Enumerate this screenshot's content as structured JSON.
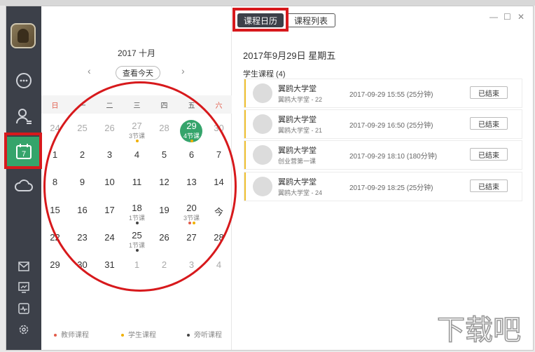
{
  "calendar": {
    "month_title": "2017 十月",
    "today_button": "查看今天",
    "weekdays": [
      "日",
      "一",
      "二",
      "三",
      "四",
      "五",
      "六"
    ],
    "weeks": [
      [
        {
          "d": "24",
          "dim": true
        },
        {
          "d": "25",
          "dim": true
        },
        {
          "d": "26",
          "dim": true
        },
        {
          "d": "27",
          "dim": true,
          "sub": "3节课",
          "dots": [
            "#f0b000"
          ]
        },
        {
          "d": "28",
          "dim": true
        },
        {
          "d": "29",
          "selected": true,
          "sub": "4节课",
          "dots": [
            "#f0b000"
          ]
        },
        {
          "d": "30",
          "dim": true
        }
      ],
      [
        {
          "d": "1"
        },
        {
          "d": "2"
        },
        {
          "d": "3"
        },
        {
          "d": "4"
        },
        {
          "d": "5"
        },
        {
          "d": "6"
        },
        {
          "d": "7"
        }
      ],
      [
        {
          "d": "8"
        },
        {
          "d": "9"
        },
        {
          "d": "10"
        },
        {
          "d": "11"
        },
        {
          "d": "12"
        },
        {
          "d": "13"
        },
        {
          "d": "14"
        }
      ],
      [
        {
          "d": "15"
        },
        {
          "d": "16"
        },
        {
          "d": "17"
        },
        {
          "d": "18",
          "sub": "1节课",
          "dots": [
            "#444444"
          ]
        },
        {
          "d": "19"
        },
        {
          "d": "20",
          "sub": "3节课",
          "dots": [
            "#e25b4a",
            "#f0b000"
          ]
        },
        {
          "d": "今"
        }
      ],
      [
        {
          "d": "22"
        },
        {
          "d": "23"
        },
        {
          "d": "24"
        },
        {
          "d": "25",
          "sub": "1节课",
          "dots": [
            "#444444"
          ]
        },
        {
          "d": "26"
        },
        {
          "d": "27"
        },
        {
          "d": "28"
        }
      ],
      [
        {
          "d": "29"
        },
        {
          "d": "30"
        },
        {
          "d": "31"
        },
        {
          "d": "1",
          "dim": true
        },
        {
          "d": "2",
          "dim": true
        },
        {
          "d": "3",
          "dim": true
        },
        {
          "d": "4",
          "dim": true
        }
      ]
    ],
    "legend": [
      {
        "label": "教师课程",
        "color": "#e25b4a"
      },
      {
        "label": "学生课程",
        "color": "#f0b000"
      },
      {
        "label": "旁听课程",
        "color": "#444444"
      }
    ]
  },
  "tabs": {
    "calendar": "课程日历",
    "list": "课程列表"
  },
  "detail": {
    "date_heading": "2017年9月29日   星期五",
    "section_title": "学生课程 (4)",
    "courses": [
      {
        "title": "翼鸥大学堂",
        "subtitle": "翼鸥大学堂 - 22",
        "time": "2017-09-29 15:55 (25分钟)",
        "status": "已结束"
      },
      {
        "title": "翼鸥大学堂",
        "subtitle": "翼鸥大学堂 - 21",
        "time": "2017-09-29 16:50 (25分钟)",
        "status": "已结束"
      },
      {
        "title": "翼鸥大学堂",
        "subtitle": "创业营第一课",
        "time": "2017-09-29 18:10 (180分钟)",
        "status": "已结束"
      },
      {
        "title": "翼鸥大学堂",
        "subtitle": "翼鸥大学堂 - 24",
        "time": "2017-09-29 18:25 (25分钟)",
        "status": "已结束"
      }
    ]
  },
  "sidebar": {
    "calendar_day": "7"
  },
  "window_controls": {
    "minimize": "—",
    "maximize": "☐",
    "close": "✕"
  },
  "watermark": {
    "text": "下载吧"
  }
}
